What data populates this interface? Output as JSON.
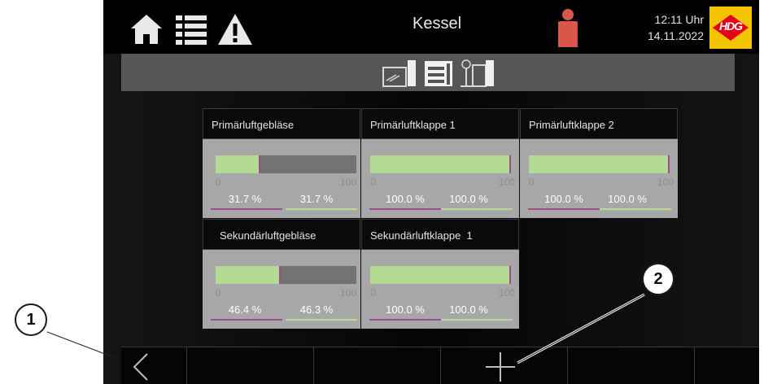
{
  "header": {
    "title": "Kessel",
    "time": "12:11 Uhr",
    "date": "14.11.2022",
    "logo_text": "HDG",
    "icons": [
      "home-icon",
      "list-icon",
      "warning-icon",
      "user-icon"
    ]
  },
  "subnav": {
    "icons": [
      "boiler-schematic-icon",
      "boiler-front-icon",
      "heat-exchanger-icon"
    ]
  },
  "panels": [
    {
      "title": "Primärluftgebläse",
      "min": "0",
      "max": "100",
      "value": 31.7,
      "setpoint": 31.7,
      "value_label": "31.7 %",
      "setpoint_label": "31.7 %"
    },
    {
      "title": "Primärluftklappe 1",
      "min": "0",
      "max": "100",
      "value": 100.0,
      "setpoint": 100.0,
      "value_label": "100.0 %",
      "setpoint_label": "100.0 %"
    },
    {
      "title": "Primärluftklappe 2",
      "min": "0",
      "max": "100",
      "value": 100.0,
      "setpoint": 100.0,
      "value_label": "100.0 %",
      "setpoint_label": "100.0 %"
    },
    {
      "title": "Sekundärluftgebläse",
      "min": "0",
      "max": "100",
      "value": 46.4,
      "setpoint": 46.3,
      "value_label": "46.4 %",
      "setpoint_label": "46.3 %"
    },
    {
      "title": "Sekundärluftklappe  1",
      "min": "0",
      "max": "100",
      "value": 100.0,
      "setpoint": 100.0,
      "value_label": "100.0 %",
      "setpoint_label": "100.0 %"
    }
  ],
  "bottombar": {
    "icons": [
      "back-icon",
      "add-icon"
    ]
  },
  "callouts": [
    "1",
    "2"
  ],
  "colors": {
    "bar_fill": "#b3db94",
    "bar_track": "#737373",
    "setpoint_marker": "#9c4c8c",
    "accent_person": "#d9574a",
    "logo_bg": "#f4c400",
    "logo_red": "#e2001a"
  }
}
